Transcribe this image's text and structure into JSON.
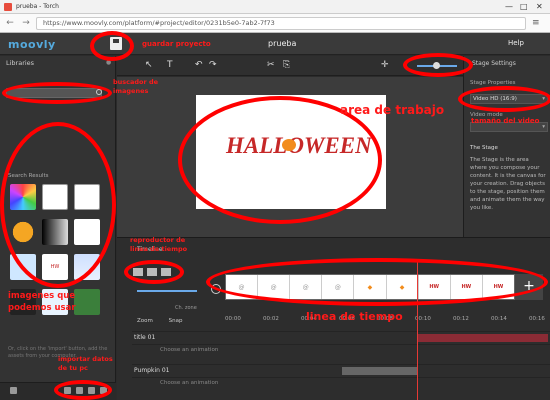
{
  "browser": {
    "tab_title": "prueba - Torch",
    "url": "https://www.moovly.com/platform/#project/editor/0231b5e0-7ab2-7f73",
    "nav_back": "←",
    "nav_forward": "→",
    "nav_reload": "⟳",
    "menu": "≡",
    "min": "—",
    "max": "□",
    "close": "✕"
  },
  "app": {
    "logo": "moovly",
    "project_title": "prueba",
    "help": "Help"
  },
  "left_panel": {
    "title": "Libraries",
    "subtitle": "Search Results",
    "footer": "Or, click on the 'import' button, add the assets from your computer."
  },
  "toolbar": {
    "undo": "↶",
    "redo": "↷",
    "cut": "✂",
    "copy": "⎘",
    "text": "T",
    "pointer": "↖"
  },
  "stage": {
    "title": "HALLOWEEN"
  },
  "right_panel": {
    "title": "Stage Settings",
    "section": "Stage Properties",
    "video_select": "Video HD (16:9)",
    "mode_label": "Video mode",
    "desc_title": "The Stage",
    "desc": "The Stage is the area where you compose your content. It is the canvas for your creation. Drag objects to the stage, position them and animate them the way you like."
  },
  "timeline": {
    "title": "Timeline",
    "checkbox_zoom": "Zoom",
    "checkbox_snap": "Snap",
    "checkbox_loop": "Ch. zone",
    "ticks": [
      "00:00",
      "00:02",
      "00:04",
      "00:06",
      "00:08",
      "00:10",
      "00:12",
      "00:14",
      "00:16"
    ],
    "tracks": [
      {
        "name": "title 01",
        "anim": "Choose an animation"
      },
      {
        "name": "Pumpkin 01",
        "anim": "Choose an animation"
      }
    ],
    "frames": [
      "@",
      "@",
      "@",
      "@",
      "◆",
      "◆",
      "HW",
      "HW",
      "HW"
    ],
    "plus": "+"
  },
  "annotations": {
    "guardar": "guardar proyecto",
    "buscador": "buscador de imagenes",
    "area": "area de trabajo",
    "tamano": "tamaño del video",
    "reproductor": "reproductor de linea de tiempo",
    "imagenes": "imagenes que podemos usar",
    "importar": "importar datos de tu pc",
    "linea": "linea de tiempo"
  },
  "colors": {
    "annotation": "#ff0000",
    "accent": "#55aadd",
    "halloween": "#c62828"
  }
}
